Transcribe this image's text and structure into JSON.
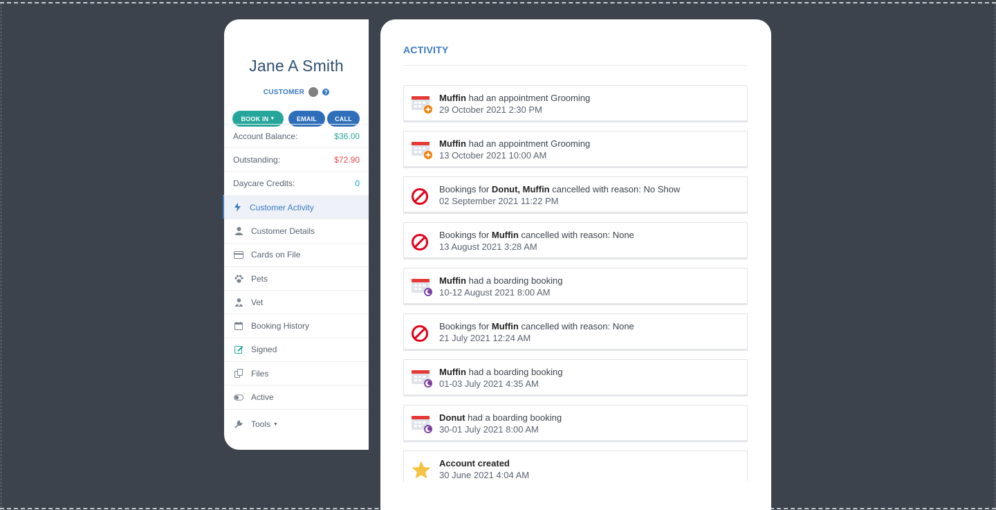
{
  "profile": {
    "name": "Jane A Smith",
    "role": "CUSTOMER",
    "buttons": {
      "book_in": "BOOK IN",
      "email": "EMAIL",
      "call": "CALL"
    },
    "stats": [
      {
        "label": "Account Balance:",
        "value": "$36.00"
      },
      {
        "label": "Outstanding:",
        "value": "$72.90"
      },
      {
        "label": "Daycare Credits:",
        "value": "0"
      }
    ],
    "nav": [
      {
        "label": "Customer Activity",
        "icon": "bolt-icon"
      },
      {
        "label": "Customer Details",
        "icon": "user-icon"
      },
      {
        "label": "Cards on File",
        "icon": "credit-card-icon"
      },
      {
        "label": "Pets",
        "icon": "paw-icon"
      },
      {
        "label": "Vet",
        "icon": "vet-icon"
      },
      {
        "label": "Booking History",
        "icon": "calendar-icon"
      },
      {
        "label": "Signed",
        "icon": "edit-icon"
      },
      {
        "label": "Files",
        "icon": "files-icon"
      },
      {
        "label": "Active",
        "icon": "toggle-icon"
      },
      {
        "label": "Tools",
        "icon": "wrench-icon"
      }
    ]
  },
  "activity": {
    "title": "ACTIVITY",
    "items": [
      {
        "icon": "appointment",
        "pre": "",
        "bold": "Muffin",
        "post": " had an appointment Grooming",
        "date": "29 October 2021 2:30 PM"
      },
      {
        "icon": "appointment",
        "pre": "",
        "bold": "Muffin",
        "post": " had an appointment Grooming",
        "date": "13 October 2021 10:00 AM"
      },
      {
        "icon": "cancelled",
        "pre": "Bookings for ",
        "bold": "Donut, Muffin",
        "post": " cancelled with reason: No Show",
        "date": "02 September 2021 11:22 PM"
      },
      {
        "icon": "cancelled",
        "pre": "Bookings for ",
        "bold": "Muffin",
        "post": " cancelled with reason: None",
        "date": "13 August 2021 3:28 AM"
      },
      {
        "icon": "boarding",
        "pre": "",
        "bold": "Muffin",
        "post": " had a boarding booking",
        "date": "10-12 August 2021 8:00 AM"
      },
      {
        "icon": "cancelled",
        "pre": "Bookings for ",
        "bold": "Muffin",
        "post": " cancelled with reason: None",
        "date": "21 July 2021 12:24 AM"
      },
      {
        "icon": "boarding",
        "pre": "",
        "bold": "Muffin",
        "post": " had a boarding booking",
        "date": "01-03 July 2021 4:35 AM"
      },
      {
        "icon": "boarding",
        "pre": "",
        "bold": "Donut",
        "post": " had a boarding booking",
        "date": "30-01 July 2021 8:00 AM"
      },
      {
        "icon": "star",
        "pre": "",
        "bold": "Account created",
        "post": "",
        "date": "30 June 2021 4:04 AM"
      }
    ]
  },
  "colors": {
    "background": "#3d434c",
    "accent_blue": "#3a7abf",
    "accent_teal": "#26a69a",
    "negative": "#e5484d"
  }
}
